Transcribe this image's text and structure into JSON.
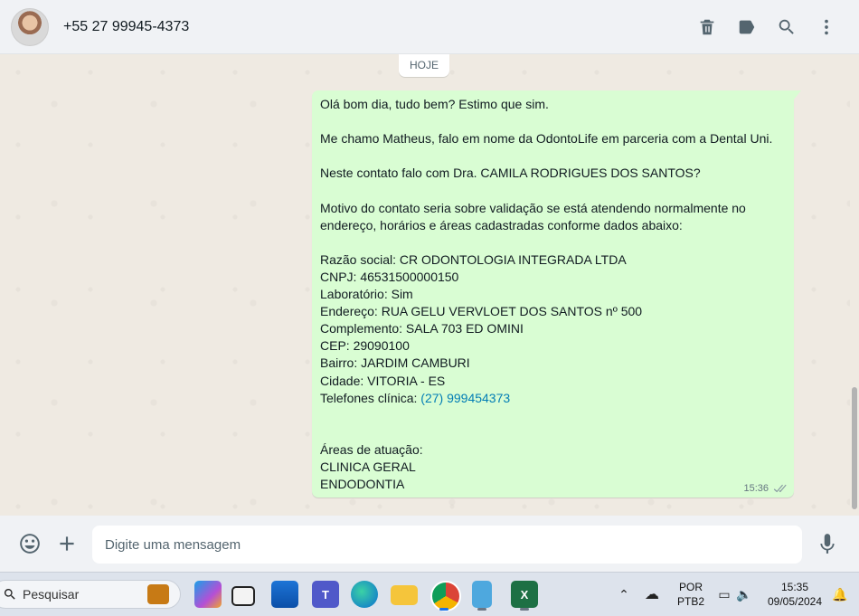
{
  "header": {
    "contact": "+55 27 99945-4373",
    "icons": [
      "trash-icon",
      "label-icon",
      "search-icon",
      "more-vertical-icon"
    ]
  },
  "chat": {
    "day_chip": "HOJE",
    "message": {
      "lines": [
        "Olá bom dia, tudo bem? Estimo que sim.",
        "",
        "Me chamo Matheus, falo em nome da OdontoLife em parceria com a Dental Uni.",
        "",
        "Neste contato falo com Dra. CAMILA RODRIGUES DOS SANTOS?",
        "",
        "Motivo do contato seria sobre validação se está atendendo normalmente no",
        "endereço, horários e áreas cadastradas conforme dados abaixo:",
        "",
        "Razão social: CR ODONTOLOGIA INTEGRADA LTDA",
        "CNPJ: 46531500000150",
        "Laboratório: Sim",
        "Endereço: RUA GELU VERVLOET DOS SANTOS nº 500",
        "Complemento: SALA 703 ED OMINI",
        "CEP: 29090100",
        "Bairro: JARDIM CAMBURI",
        "Cidade: VITORIA - ES"
      ],
      "phone_label": "Telefones clínica: ",
      "phone_link": "(27) 999454373",
      "tail_lines": [
        "",
        "",
        "Áreas de atuação:",
        "CLINICA GERAL",
        "ENDODONTIA"
      ],
      "time": "15:36",
      "status": "read"
    }
  },
  "composer": {
    "placeholder": "Digite uma mensagem",
    "value": ""
  },
  "taskbar": {
    "search_label": "Pesquisar",
    "apps": [
      "copilot",
      "task-view",
      "store",
      "teams",
      "edge",
      "file-explorer",
      "chrome",
      "notepad",
      "excel"
    ],
    "lang_top": "POR",
    "lang_bottom": "PTB2",
    "time": "15:35",
    "date": "09/05/2024"
  }
}
